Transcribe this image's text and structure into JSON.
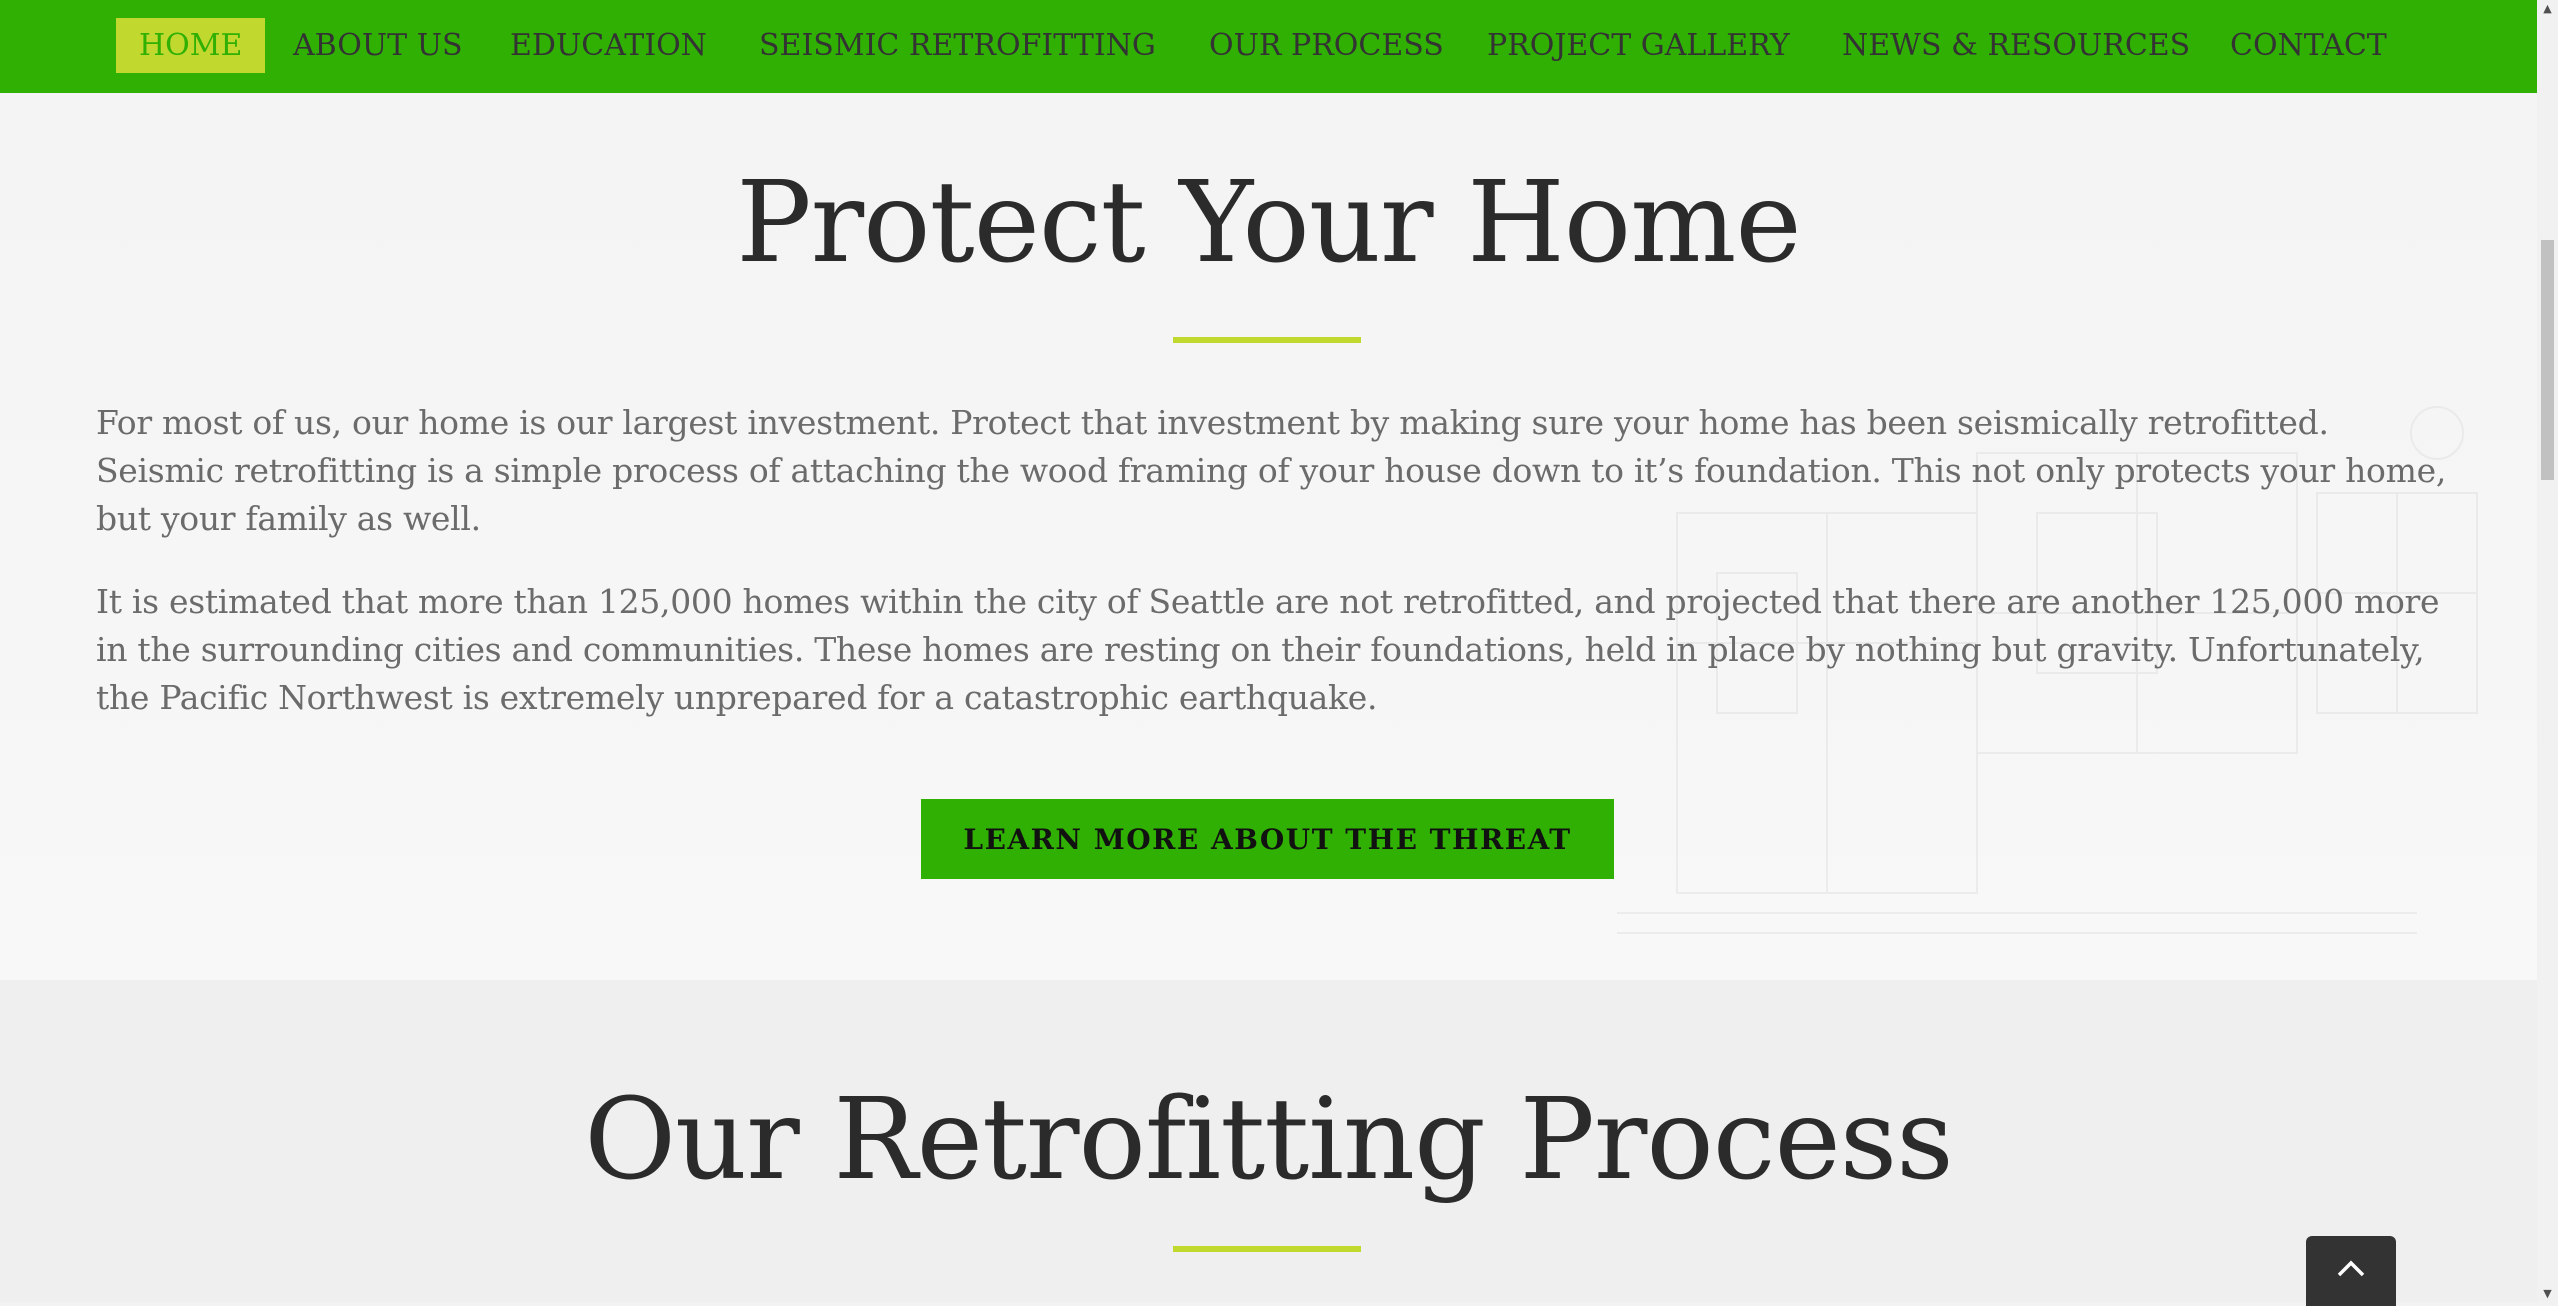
{
  "nav": {
    "items": [
      {
        "label": "HOME",
        "active": true
      },
      {
        "label": "ABOUT US"
      },
      {
        "label": "EDUCATION"
      },
      {
        "label": "SEISMIC RETROFITTING"
      },
      {
        "label": "OUR PROCESS"
      },
      {
        "label": "PROJECT GALLERY"
      },
      {
        "label": "NEWS & RESOURCES"
      },
      {
        "label": "CONTACT"
      }
    ]
  },
  "protect": {
    "title": "Protect Your Home",
    "paragraph1": "For most of us, our home is our largest investment.  Protect that investment by making sure your home has been seismically retrofitted.  Seismic retrofitting is a simple process of attaching the wood framing of your house down to it’s foundation.  This not only protects your home, but your family as well.",
    "paragraph2": "It is estimated that more than 125,000 homes within the city of Seattle are not retrofitted, and projected that there are another 125,000 more in the surrounding cities and communities.  These homes are resting on their foundations, held in place by nothing but gravity.  Unfortunately, the Pacific Northwest is extremely unprepared for a catastrophic earthquake.",
    "cta_label": "LEARN MORE ABOUT THE THREAT"
  },
  "process": {
    "title": "Our Retrofitting Process"
  },
  "colors": {
    "nav_green": "#31b004",
    "accent_lime": "#c1d82f",
    "heading_text": "#2b2b2b",
    "body_text": "#6b6b6b"
  },
  "icons": {
    "scroll_up": "triangle-up-icon",
    "scroll_down": "triangle-down-icon",
    "back_to_top": "chevron-up-icon"
  }
}
